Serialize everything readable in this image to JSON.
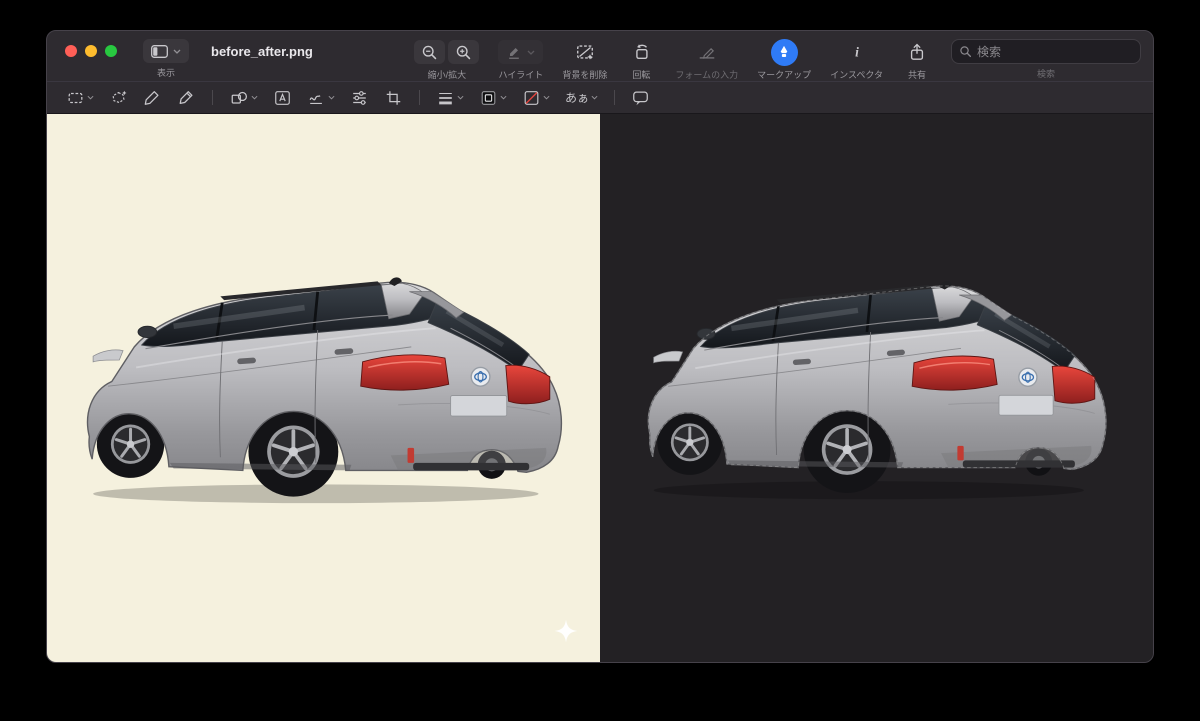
{
  "window": {
    "title": "before_after.png"
  },
  "titlebar": {
    "view_label": "表示",
    "zoom_label": "縮小/拡大",
    "highlight_label": "ハイライト",
    "remove_bg_label": "背景を削除",
    "rotate_label": "回転",
    "form_label": "フォームの入力",
    "markup_label": "マークアップ",
    "inspector_label": "インスペクタ",
    "share_label": "共有",
    "search_label": "検索",
    "search_placeholder": "検索"
  },
  "markup_toolbar": {
    "text_style_label": "あぁ"
  },
  "colors": {
    "accent_blue": "#2f7bf6",
    "chrome": "#2e2b30",
    "left_canvas_bg": "#f5f1de",
    "right_canvas_bg": "#232124",
    "traffic_red": "#ff5f57",
    "traffic_yellow": "#febc2e",
    "traffic_green": "#28c840",
    "car_body_silver": "#bdbdc1",
    "taillight_red": "#b5302c"
  }
}
